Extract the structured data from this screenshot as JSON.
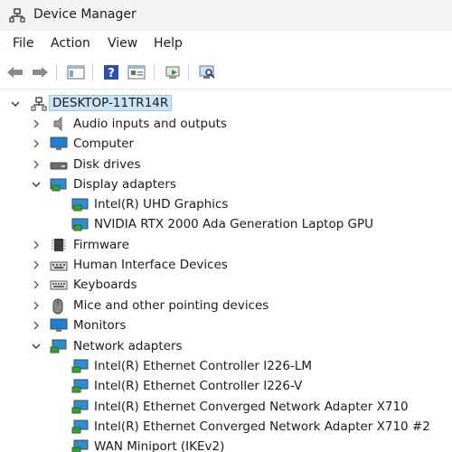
{
  "window": {
    "title": "Device Manager",
    "icon": "device-manager-icon"
  },
  "menu": [
    "File",
    "Action",
    "View",
    "Help"
  ],
  "toolbar": [
    "back-arrow-icon",
    "forward-arrow-icon",
    "show-hide-console-tree-icon",
    "help-icon",
    "properties-icon",
    "update-driver-icon",
    "scan-hardware-icon"
  ],
  "tree": {
    "root": "DESKTOP-11TR14R",
    "items": [
      {
        "label": "Audio inputs and outputs",
        "expanded": false,
        "icon": "speaker-icon"
      },
      {
        "label": "Computer",
        "expanded": false,
        "icon": "monitor-icon"
      },
      {
        "label": "Disk drives",
        "expanded": false,
        "icon": "disk-drive-icon"
      },
      {
        "label": "Display adapters",
        "expanded": true,
        "icon": "display-adapter-icon",
        "children": [
          "Intel(R) UHD Graphics",
          "NVIDIA RTX 2000 Ada Generation Laptop GPU"
        ]
      },
      {
        "label": "Firmware",
        "expanded": false,
        "icon": "firmware-chip-icon"
      },
      {
        "label": "Human Interface Devices",
        "expanded": false,
        "icon": "hid-keyboard-icon"
      },
      {
        "label": "Keyboards",
        "expanded": false,
        "icon": "keyboard-icon"
      },
      {
        "label": "Mice and other pointing devices",
        "expanded": false,
        "icon": "mouse-icon"
      },
      {
        "label": "Monitors",
        "expanded": false,
        "icon": "monitor-icon"
      },
      {
        "label": "Network adapters",
        "expanded": true,
        "icon": "network-adapter-icon",
        "children": [
          "Intel(R) Ethernet Controller I226-LM",
          "Intel(R) Ethernet Controller I226-V",
          "Intel(R) Ethernet Converged Network Adapter X710",
          "Intel(R) Ethernet Converged Network Adapter X710 #2",
          "WAN Miniport (IKEv2)"
        ]
      }
    ]
  }
}
